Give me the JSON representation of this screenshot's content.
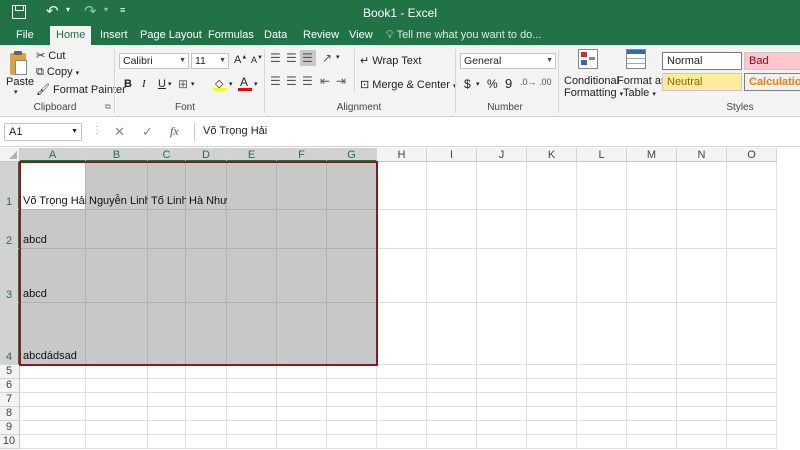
{
  "titlebar": {
    "title": "Book1 - Excel",
    "undo_icon": "undo-icon",
    "redo_icon": "redo-icon"
  },
  "tabs": [
    {
      "label": "File"
    },
    {
      "label": "Home",
      "active": true
    },
    {
      "label": "Insert"
    },
    {
      "label": "Page Layout"
    },
    {
      "label": "Formulas"
    },
    {
      "label": "Data"
    },
    {
      "label": "Review"
    },
    {
      "label": "View"
    }
  ],
  "tell_me": "Tell me what you want to do...",
  "clipboard": {
    "paste": "Paste",
    "cut": "Cut",
    "copy": "Copy",
    "format_painter": "Format Painter",
    "label": "Clipboard"
  },
  "font": {
    "name": "Calibri",
    "size": "11",
    "bold": "B",
    "italic": "I",
    "underline": "U",
    "label": "Font",
    "fill_color": "#ffff00",
    "font_color": "#ff0000"
  },
  "alignment": {
    "wrap_text": "Wrap Text",
    "merge_center": "Merge & Center",
    "label": "Alignment"
  },
  "number": {
    "format": "General",
    "currency": "$",
    "percent": "%",
    "comma": "9",
    "label": "Number"
  },
  "styles": {
    "conditional_1": "Conditional",
    "conditional_2": "Formatting",
    "format_as_1": "Format as",
    "format_as_2": "Table",
    "normal": "Normal",
    "bad": "Bad",
    "neutral": "Neutral",
    "calculation": "Calculation",
    "label": "Styles"
  },
  "formula_bar": {
    "name_box": "A1",
    "fx": "fx",
    "content": "Võ Trọng Hải"
  },
  "columns": [
    "A",
    "B",
    "C",
    "D",
    "E",
    "F",
    "G",
    "H",
    "I",
    "J",
    "K",
    "L",
    "M",
    "N",
    "O"
  ],
  "rows": [
    "1",
    "2",
    "3",
    "4",
    "5",
    "6",
    "7",
    "8",
    "9",
    "10"
  ],
  "cells": {
    "A1": "Võ Trọng Hải",
    "B1": "Nguyễn Linh",
    "C1": "Tố Linh",
    "D1": "Hà Như",
    "A2": "abcd",
    "A3": "abcd",
    "A4": "abcdádsad"
  },
  "colors": {
    "accent": "#217346",
    "selection_border": "#8b1a1a"
  }
}
